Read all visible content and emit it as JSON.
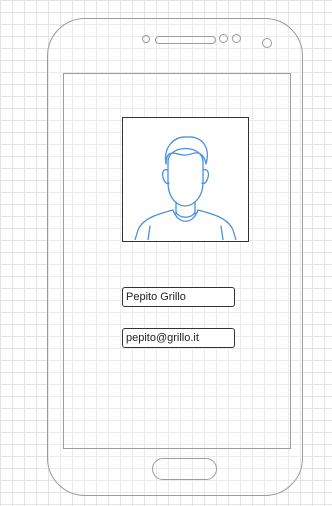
{
  "profile": {
    "name_value": "Pepito Grillo",
    "email_value": "pepito@grillo.it"
  },
  "icons": {
    "avatar": "person-silhouette-icon"
  },
  "colors": {
    "avatar_stroke": "#4a90e2",
    "frame_stroke": "#9b9b9b",
    "grid": "#e4e4e4"
  }
}
